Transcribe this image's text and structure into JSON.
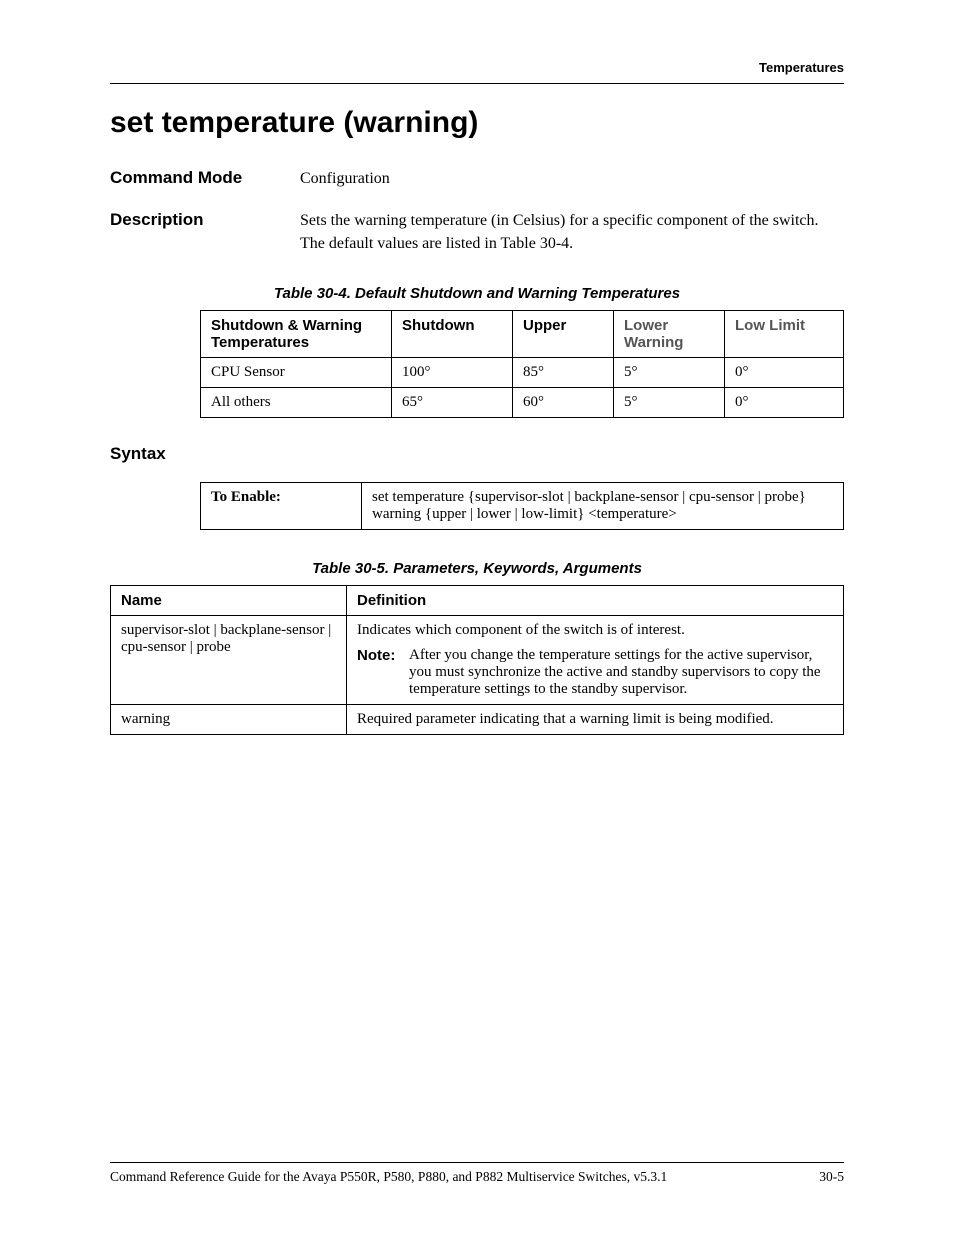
{
  "header": {
    "section": "Temperatures"
  },
  "title": "set temperature (warning)",
  "commandMode": {
    "label": "Command Mode",
    "value": "Configuration"
  },
  "description": {
    "label": "Description",
    "value": "Sets the warning temperature (in Celsius) for a specific component of the switch. The default values are listed in Table 30-4."
  },
  "table30_4": {
    "caption": "Table 30-4.   Default Shutdown and Warning Temperatures",
    "headers": {
      "col1": "Shutdown & Warning Temperatures",
      "col2": "Shutdown",
      "col3": "Upper",
      "col4": "Lower Warning",
      "col5": "Low Limit"
    },
    "rows": [
      {
        "name": "CPU Sensor",
        "shutdown": "100°",
        "upper": "85°",
        "lower": "5°",
        "low": "0°"
      },
      {
        "name": "All others",
        "shutdown": "65°",
        "upper": "60°",
        "lower": "5°",
        "low": "0°"
      }
    ]
  },
  "syntax": {
    "heading": "Syntax",
    "enableLabel": "To Enable:",
    "enableText": "set temperature {supervisor-slot | backplane-sensor | cpu-sensor | probe} warning {upper | lower | low-limit} <temperature>"
  },
  "table30_5": {
    "caption": "Table 30-5.  Parameters, Keywords, Arguments",
    "headers": {
      "name": "Name",
      "definition": "Definition"
    },
    "rows": [
      {
        "name": "supervisor-slot | backplane-sensor | cpu-sensor | probe",
        "definition": "Indicates which component of the switch is of interest.",
        "noteLabel": "Note:",
        "note": "After you change the temperature settings for the active supervisor, you must synchronize the active and standby supervisors to copy the temperature settings to the standby supervisor."
      },
      {
        "name": "warning",
        "definition": "Required parameter indicating that a warning limit is being modified."
      }
    ]
  },
  "footer": {
    "left": "Command Reference Guide for the Avaya P550R, P580, P880, and P882 Multiservice Switches, v5.3.1",
    "right": "30-5"
  }
}
